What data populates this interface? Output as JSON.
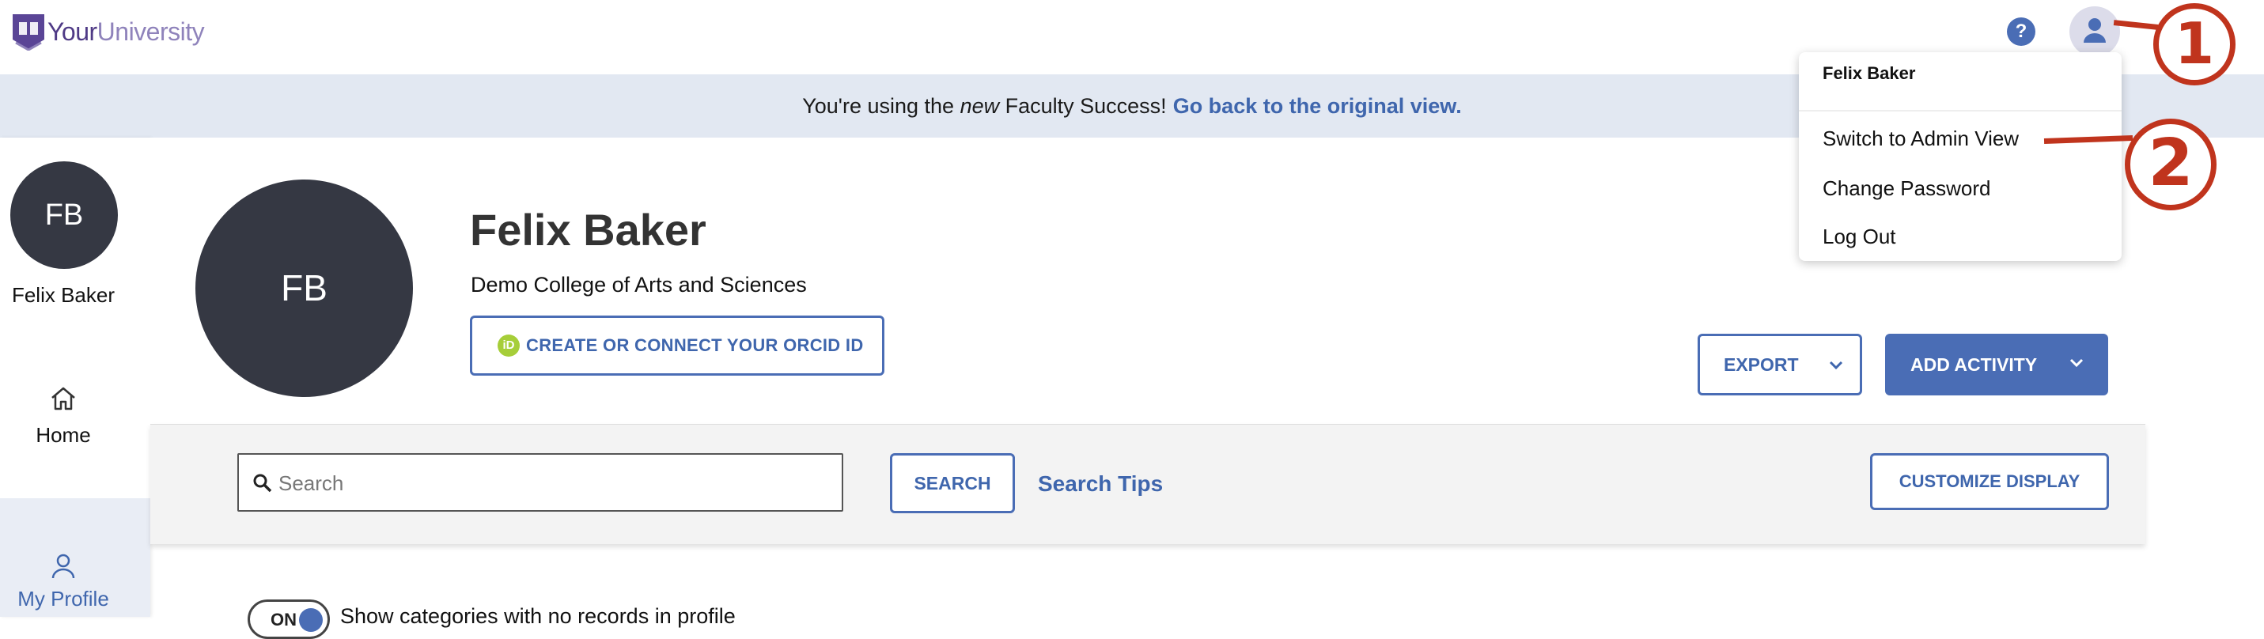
{
  "header": {
    "logo_text_a": "Your",
    "logo_text_b": "University",
    "help_icon": "question-icon",
    "user_icon": "person-icon"
  },
  "banner": {
    "text_before": "You're using the",
    "text_em": "new",
    "text_after": "Faculty Success!",
    "link": "Go back to the original view."
  },
  "sidebar": {
    "initials": "FB",
    "name": "Felix Baker",
    "items": [
      {
        "label": "Home",
        "icon": "home-icon"
      },
      {
        "label": "My Profile",
        "icon": "person-icon"
      }
    ]
  },
  "profile": {
    "initials": "FB",
    "name": "Felix Baker",
    "college": "Demo College of Arts and Sciences",
    "orcid_label": "CREATE OR CONNECT YOUR ORCID ID",
    "orcid_icon_text": "iD",
    "export_label": "EXPORT",
    "add_activity_label": "ADD ACTIVITY"
  },
  "search": {
    "placeholder": "Search",
    "value": "",
    "search_button": "SEARCH",
    "tips_link": "Search Tips",
    "customize_button": "CUSTOMIZE DISPLAY"
  },
  "toggle": {
    "state_label": "ON",
    "label": "Show categories with no records in profile"
  },
  "user_menu": {
    "header": "Felix Baker",
    "items": [
      "Switch to Admin View",
      "Change Password",
      "Log Out"
    ]
  },
  "annotations": {
    "one": "1",
    "two": "2"
  },
  "colors": {
    "accent": "#4a6db5",
    "link": "#3f66ad",
    "avatar_bg": "#353843",
    "banner_bg": "#e2e8f2",
    "annotation": "#c0341d"
  }
}
